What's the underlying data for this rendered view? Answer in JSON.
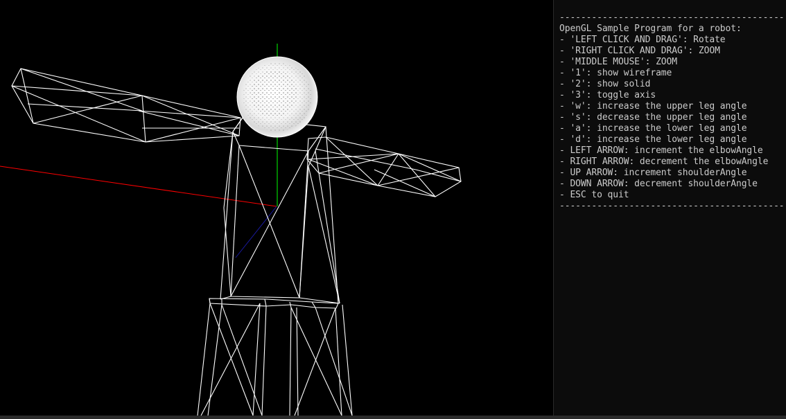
{
  "colors": {
    "background": "#000000",
    "wireframe": "#ffffff",
    "axis_x": "#ff0000",
    "axis_y": "#00ff00",
    "axis_z": "#0000ff",
    "console_background": "#0c0c0c",
    "console_text": "#cccccc"
  },
  "console": {
    "lines": [
      "------------------------------------------",
      "OpenGL Sample Program for a robot:",
      "- 'LEFT CLICK AND DRAG': Rotate",
      "- 'RIGHT CLICK AND DRAG': ZOOM",
      "- 'MIDDLE MOUSE': ZOOM",
      "- '1': show wireframe",
      "- '2': show solid",
      "- '3': toggle axis",
      "- 'w': increase the upper leg angle",
      "- 's': decrease the upper leg angle",
      "- 'a': increase the lower leg angle",
      "- 'd': increase the lower leg angle",
      "- LEFT ARROW: increment the elbowAngle",
      "- RIGHT ARROW: decrement the elbowAngle",
      "- UP ARROW: increment shoulderAngle",
      "- DOWN ARROW: decrement shoulderAngle",
      "- ESC to quit",
      "------------------------------------------"
    ]
  }
}
